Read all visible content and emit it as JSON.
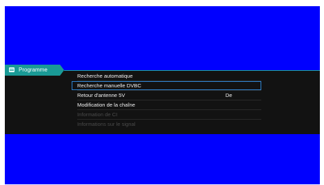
{
  "sidebar": {
    "tab_label": "Programme",
    "tab_icon": "list-icon"
  },
  "menu": {
    "items": [
      {
        "label": "Recherche automatique",
        "value": "",
        "enabled": true
      },
      {
        "label": "Recherche manuelle DVBC",
        "value": "",
        "enabled": true,
        "selected": true
      },
      {
        "label": "Retour d'antenne 5V",
        "value": "De",
        "enabled": true
      },
      {
        "label": "Modification de la chaîne",
        "value": "",
        "enabled": true
      },
      {
        "label": "Information de CI",
        "value": "",
        "enabled": false
      },
      {
        "label": "Informations sur le signal",
        "value": "",
        "enabled": false
      }
    ]
  },
  "colors": {
    "background": "#0000ff",
    "panel": "#121212",
    "accent": "#1a9a96",
    "selection": "#2f86d6"
  }
}
